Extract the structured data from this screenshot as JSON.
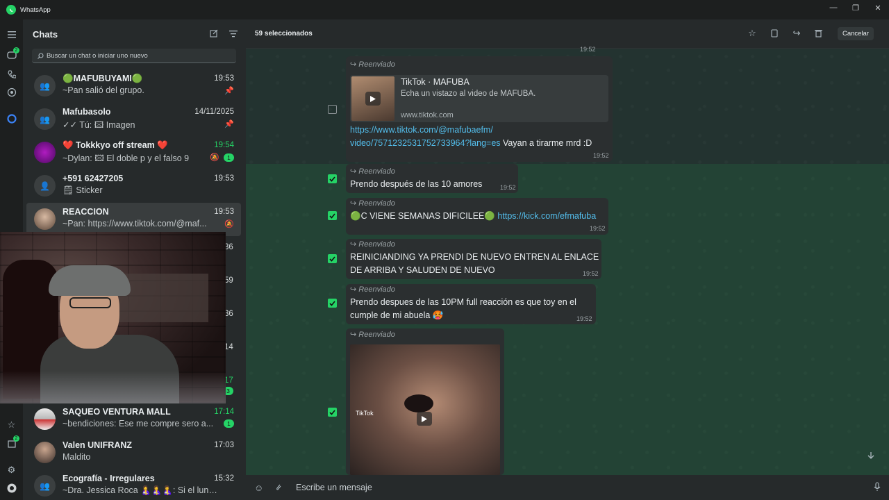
{
  "window": {
    "title": "WhatsApp"
  },
  "sidebar": {
    "title": "Chats",
    "search_placeholder": "Buscar un chat o iniciar uno nuevo"
  },
  "chats": [
    {
      "name": "🟢MAFUBUYAMI🟢",
      "preview": "~Pan salió del grupo.",
      "time": "19:53",
      "pinned": true
    },
    {
      "name": "Mafubasolo",
      "preview": "✓✓ Tú: 🖾 Imagen",
      "time": "14/11/2025",
      "pinned": true
    },
    {
      "name": "❤️ Tokkkyo off stream ❤️",
      "preview": "~Dylan: 🖾 El doble p y el falso 9",
      "time": "19:54",
      "time_green": true,
      "muted": true,
      "unread": "1"
    },
    {
      "name": "+591 62427205",
      "preview": "🗒 Sticker",
      "time": "19:53"
    },
    {
      "name": "REACCION",
      "preview": "~Pan: https://www.tiktok.com/@maf...",
      "time": "19:53",
      "muted": true,
      "active": true
    },
    {
      "name": "SAQUEO VENTURA MALL",
      "preview": "~bendiciones: Ese me compre sero a...",
      "time": "17:14",
      "time_green": true,
      "unread": "1"
    },
    {
      "name": "Valen UNIFRANZ",
      "preview": "Maldito",
      "time": "17:03"
    },
    {
      "name": "Ecografía - Irregulares",
      "preview": "~Dra. Jessica Roca 🤱🤱🤱: Si el lunes...",
      "time": "15:32"
    }
  ],
  "hidden_row_fragments": [
    {
      "time": "36"
    },
    {
      "time": "59"
    },
    {
      "time": "36"
    },
    {
      "time": "14"
    },
    {
      "time": "17",
      "unread": "3"
    }
  ],
  "header": {
    "selected": "59 seleccionados",
    "cancel": "Cancelar"
  },
  "messages": {
    "top_time": "19:52",
    "m1": {
      "forwarded": "Reenviado",
      "card_title": "TikTok · MAFUBA",
      "card_desc": "Echa un vistazo al video de MAFUBA.",
      "card_domain": "www.tiktok.com",
      "link_line1": "https://www.tiktok.com/@mafubaefm/",
      "link_line2": "video/7571232531752733964?lang=es",
      "text_after": " Vayan a tirarme mrd :D",
      "time": "19:52"
    },
    "m2": {
      "forwarded": "Reenviado",
      "text": "Prendo después de las 10 amores",
      "time": "19:52"
    },
    "m3": {
      "forwarded": "Reenviado",
      "text": "🟢C VIENE SEMANAS DIFICILEE🟢 ",
      "link": "https://kick.com/efmafuba",
      "time": "19:52"
    },
    "m4": {
      "forwarded": "Reenviado",
      "line1": "REINICIANDING YA PRENDI DE NUEVO ENTREN AL ENLACE",
      "line2": "DE ARRIBA Y SALUDEN DE NUEVO",
      "time": "19:52"
    },
    "m5": {
      "forwarded": "Reenviado",
      "line1": "Prendo despues de las 10PM full reacción es que toy en el",
      "line2": "cumple de mi abuela 🥵",
      "time": "19:52"
    },
    "m6": {
      "forwarded": "Reenviado",
      "video_label": "TikTok"
    }
  },
  "composer": {
    "placeholder": "Escribe un mensaje"
  },
  "colors": {
    "accent": "#25d366",
    "link": "#53bdeb",
    "panel": "#262a2b"
  },
  "icons": [
    "menu-icon",
    "chats-icon",
    "calls-icon",
    "status-icon",
    "meta-ai-icon",
    "star-icon",
    "archive-icon",
    "settings-icon",
    "profile-icon",
    "new-chat-icon",
    "filter-icon",
    "search-icon",
    "pin-icon",
    "mute-icon",
    "copy-icon",
    "forward-icon",
    "delete-icon",
    "emoji-icon",
    "attach-icon",
    "mic-icon",
    "arrow-down-icon",
    "play-icon"
  ]
}
